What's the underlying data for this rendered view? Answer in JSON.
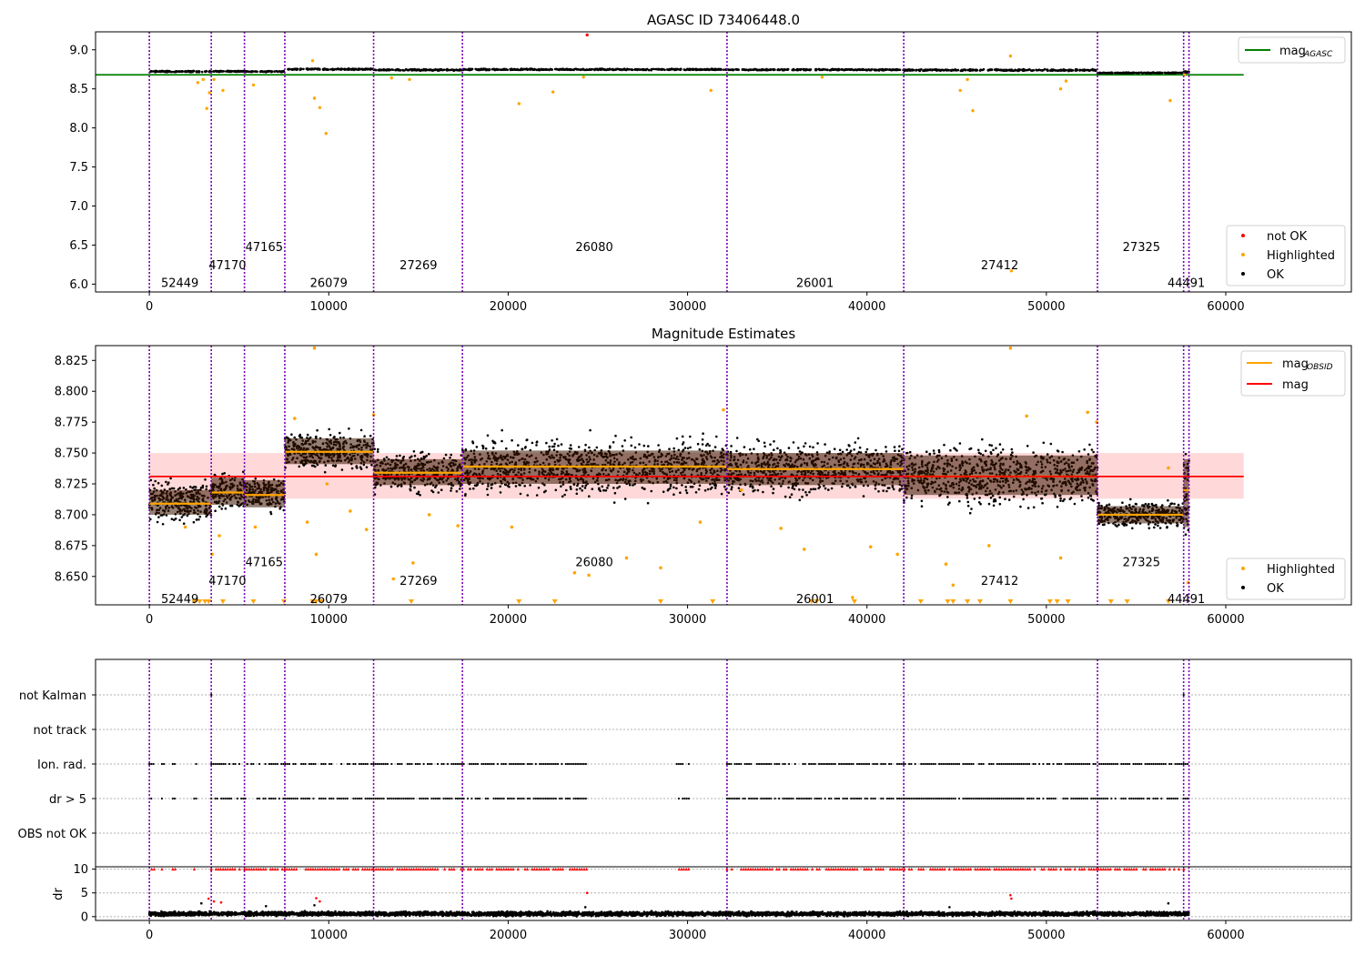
{
  "chart_data": [
    {
      "type": "scatter",
      "title": "AGASC ID 73406448.0",
      "xlim": [
        -3000,
        67000
      ],
      "ylim": [
        5.9,
        9.23
      ],
      "xticks": [
        0,
        10000,
        20000,
        30000,
        40000,
        50000,
        60000
      ],
      "xtick_labels": [
        "0",
        "10000",
        "20000",
        "30000",
        "40000",
        "50000",
        "60000"
      ],
      "yticks": [
        6.0,
        6.5,
        7.0,
        7.5,
        8.0,
        8.5,
        9.0
      ],
      "ytick_labels": [
        "6.0",
        "6.5",
        "7.0",
        "7.5",
        "8.0",
        "8.5",
        "9.0"
      ],
      "grid": false,
      "reference_line": {
        "name": "mag_AGASC",
        "y": 8.68,
        "x": [
          -3000,
          61000
        ],
        "color": "#008000"
      },
      "legend_lines": {
        "label": "mag",
        "sub": "AGASC",
        "placement": "top-right"
      },
      "legend_points": {
        "placement": "bottom-right",
        "items": [
          {
            "label": "not OK",
            "color": "#ff0000"
          },
          {
            "label": "Highlighted",
            "color": "#ffa500"
          },
          {
            "label": "OK",
            "color": "#000000"
          }
        ]
      },
      "obsid_boundaries": [
        0,
        3450,
        5300,
        7550,
        12500,
        17450,
        32200,
        42050,
        52850,
        57650,
        57950
      ],
      "obsid_labels": [
        {
          "text": "52449",
          "x": 1700,
          "y": 6.02
        },
        {
          "text": "47170",
          "x": 4350,
          "y": 6.25
        },
        {
          "text": "47165",
          "x": 6400,
          "y": 6.48
        },
        {
          "text": "26079",
          "x": 10000,
          "y": 6.02
        },
        {
          "text": "27269",
          "x": 15000,
          "y": 6.25
        },
        {
          "text": "26080",
          "x": 24800,
          "y": 6.48
        },
        {
          "text": "26001",
          "x": 37100,
          "y": 6.02
        },
        {
          "text": "27412",
          "x": 47400,
          "y": 6.25
        },
        {
          "text": "27325",
          "x": 55300,
          "y": 6.48
        },
        {
          "text": "44491",
          "x": 57800,
          "y": 6.02
        }
      ],
      "band_series": [
        {
          "x": [
            0,
            3450
          ],
          "center": 8.722,
          "spread": 0.012
        },
        {
          "x": [
            3450,
            5300
          ],
          "center": 8.724,
          "spread": 0.01
        },
        {
          "x": [
            5300,
            7550
          ],
          "center": 8.722,
          "spread": 0.01
        },
        {
          "x": [
            7550,
            12500
          ],
          "center": 8.752,
          "spread": 0.012
        },
        {
          "x": [
            12500,
            17450
          ],
          "center": 8.742,
          "spread": 0.012
        },
        {
          "x": [
            17450,
            32200
          ],
          "center": 8.748,
          "spread": 0.013
        },
        {
          "x": [
            32200,
            42050
          ],
          "center": 8.745,
          "spread": 0.012
        },
        {
          "x": [
            42050,
            52850
          ],
          "center": 8.74,
          "spread": 0.014
        },
        {
          "x": [
            52850,
            57650
          ],
          "center": 8.705,
          "spread": 0.008
        },
        {
          "x": [
            57650,
            57950
          ],
          "center": 8.715,
          "spread": 0.02
        }
      ],
      "highlighted_points": [
        {
          "x": 2700,
          "y": 8.58
        },
        {
          "x": 3000,
          "y": 8.62
        },
        {
          "x": 3200,
          "y": 8.25
        },
        {
          "x": 3350,
          "y": 8.45
        },
        {
          "x": 3600,
          "y": 8.62
        },
        {
          "x": 4100,
          "y": 8.48
        },
        {
          "x": 5800,
          "y": 8.55
        },
        {
          "x": 9100,
          "y": 8.86
        },
        {
          "x": 9200,
          "y": 8.38
        },
        {
          "x": 9500,
          "y": 8.26
        },
        {
          "x": 9850,
          "y": 7.93
        },
        {
          "x": 13500,
          "y": 8.64
        },
        {
          "x": 14500,
          "y": 8.62
        },
        {
          "x": 20600,
          "y": 8.31
        },
        {
          "x": 22500,
          "y": 8.46
        },
        {
          "x": 24200,
          "y": 8.65
        },
        {
          "x": 31300,
          "y": 8.48
        },
        {
          "x": 37500,
          "y": 8.65
        },
        {
          "x": 45200,
          "y": 8.48
        },
        {
          "x": 45600,
          "y": 8.62
        },
        {
          "x": 45900,
          "y": 8.22
        },
        {
          "x": 48000,
          "y": 8.92
        },
        {
          "x": 48050,
          "y": 6.17
        },
        {
          "x": 50800,
          "y": 8.5
        },
        {
          "x": 51100,
          "y": 8.6
        },
        {
          "x": 56900,
          "y": 8.35
        },
        {
          "x": 57700,
          "y": 8.68
        }
      ],
      "notok_points": [
        {
          "x": 24400,
          "y": 9.19
        }
      ]
    },
    {
      "type": "scatter",
      "title": "Magnitude Estimates",
      "xlim": [
        -3000,
        67000
      ],
      "ylim": [
        8.627,
        8.837
      ],
      "xticks": [
        0,
        10000,
        20000,
        30000,
        40000,
        50000,
        60000
      ],
      "xtick_labels": [
        "0",
        "10000",
        "20000",
        "30000",
        "40000",
        "50000",
        "60000"
      ],
      "yticks": [
        8.65,
        8.675,
        8.7,
        8.725,
        8.75,
        8.775,
        8.8,
        8.825
      ],
      "ytick_labels": [
        "8.650",
        "8.675",
        "8.700",
        "8.725",
        "8.750",
        "8.775",
        "8.800",
        "8.825"
      ],
      "grid": false,
      "mag_line": {
        "name": "mag",
        "y": 8.731,
        "x": [
          0,
          61000
        ],
        "color": "#ff0000"
      },
      "mag_band": {
        "y": [
          8.713,
          8.75
        ],
        "x": [
          0,
          61000
        ],
        "color": "#ffcccc"
      },
      "legend_lines": {
        "placement": "top-right",
        "items": [
          {
            "label": "mag",
            "sub": "OBSID",
            "color": "#ffa500"
          },
          {
            "label": "mag",
            "sub": "",
            "color": "#ff0000"
          }
        ]
      },
      "legend_points": {
        "placement": "bottom-right",
        "items": [
          {
            "label": "Highlighted",
            "color": "#ffa500"
          },
          {
            "label": "OK",
            "color": "#000000"
          }
        ]
      },
      "obsid_boundaries": [
        0,
        3450,
        5300,
        7550,
        12500,
        17450,
        32200,
        42050,
        52850,
        57650,
        57950
      ],
      "obsid_labels": [
        {
          "text": "52449",
          "x": 1700,
          "y": 8.632
        },
        {
          "text": "47170",
          "x": 4350,
          "y": 8.647
        },
        {
          "text": "47165",
          "x": 6400,
          "y": 8.662
        },
        {
          "text": "26079",
          "x": 10000,
          "y": 8.632
        },
        {
          "text": "27269",
          "x": 15000,
          "y": 8.647
        },
        {
          "text": "26080",
          "x": 24800,
          "y": 8.662
        },
        {
          "text": "26001",
          "x": 37100,
          "y": 8.632
        },
        {
          "text": "27412",
          "x": 47400,
          "y": 8.647
        },
        {
          "text": "27325",
          "x": 55300,
          "y": 8.662
        },
        {
          "text": "44491",
          "x": 57800,
          "y": 8.632
        }
      ],
      "obsid_means": [
        {
          "x": [
            0,
            3450
          ],
          "mag": 8.709,
          "band": [
            8.7,
            8.72
          ],
          "spread": [
            8.69,
            8.735
          ]
        },
        {
          "x": [
            3450,
            5300
          ],
          "mag": 8.718,
          "band": [
            8.708,
            8.73
          ],
          "spread": [
            8.702,
            8.742
          ]
        },
        {
          "x": [
            5300,
            7550
          ],
          "mag": 8.716,
          "band": [
            8.706,
            8.728
          ],
          "spread": [
            8.702,
            8.74
          ]
        },
        {
          "x": [
            7550,
            12500
          ],
          "mag": 8.751,
          "band": [
            8.741,
            8.762
          ],
          "spread": [
            8.73,
            8.772
          ]
        },
        {
          "x": [
            12500,
            17450
          ],
          "mag": 8.734,
          "band": [
            8.724,
            8.745
          ],
          "spread": [
            8.712,
            8.755
          ]
        },
        {
          "x": [
            17450,
            32200
          ],
          "mag": 8.739,
          "band": [
            8.725,
            8.752
          ],
          "spread": [
            8.71,
            8.772
          ]
        },
        {
          "x": [
            32200,
            42050
          ],
          "mag": 8.737,
          "band": [
            8.724,
            8.75
          ],
          "spread": [
            8.712,
            8.768
          ]
        },
        {
          "x": [
            42050,
            52850
          ],
          "mag": 8.731,
          "band": [
            8.716,
            8.748
          ],
          "spread": [
            8.702,
            8.768
          ]
        },
        {
          "x": [
            52850,
            57650
          ],
          "mag": 8.7,
          "band": [
            8.693,
            8.707
          ],
          "spread": [
            8.688,
            8.716
          ]
        },
        {
          "x": [
            57650,
            57950
          ],
          "mag": 8.72,
          "band": [
            8.69,
            8.745
          ],
          "spread": [
            8.675,
            8.765
          ]
        }
      ],
      "highlighted_points": [
        {
          "x": 9200,
          "y": 8.835
        },
        {
          "x": 48000,
          "y": 8.835
        },
        {
          "x": 2000,
          "y": 8.69
        },
        {
          "x": 3500,
          "y": 8.668
        },
        {
          "x": 3900,
          "y": 8.683
        },
        {
          "x": 5900,
          "y": 8.69
        },
        {
          "x": 8100,
          "y": 8.778
        },
        {
          "x": 8800,
          "y": 8.694
        },
        {
          "x": 9300,
          "y": 8.668
        },
        {
          "x": 9900,
          "y": 8.725
        },
        {
          "x": 11200,
          "y": 8.703
        },
        {
          "x": 12100,
          "y": 8.688
        },
        {
          "x": 12500,
          "y": 8.781
        },
        {
          "x": 13600,
          "y": 8.648
        },
        {
          "x": 14700,
          "y": 8.661
        },
        {
          "x": 15600,
          "y": 8.7
        },
        {
          "x": 17200,
          "y": 8.691
        },
        {
          "x": 20200,
          "y": 8.69
        },
        {
          "x": 23700,
          "y": 8.653
        },
        {
          "x": 24500,
          "y": 8.651
        },
        {
          "x": 26600,
          "y": 8.665
        },
        {
          "x": 28500,
          "y": 8.657
        },
        {
          "x": 30700,
          "y": 8.694
        },
        {
          "x": 32000,
          "y": 8.785
        },
        {
          "x": 33000,
          "y": 8.72
        },
        {
          "x": 35200,
          "y": 8.689
        },
        {
          "x": 36500,
          "y": 8.672
        },
        {
          "x": 39200,
          "y": 8.633
        },
        {
          "x": 40200,
          "y": 8.674
        },
        {
          "x": 41700,
          "y": 8.668
        },
        {
          "x": 44400,
          "y": 8.66
        },
        {
          "x": 44800,
          "y": 8.643
        },
        {
          "x": 46800,
          "y": 8.675
        },
        {
          "x": 48900,
          "y": 8.78
        },
        {
          "x": 50800,
          "y": 8.665
        },
        {
          "x": 52300,
          "y": 8.783
        },
        {
          "x": 52800,
          "y": 8.775
        },
        {
          "x": 56800,
          "y": 8.738
        },
        {
          "x": 57900,
          "y": 8.645
        }
      ],
      "low_markers_x": [
        2500,
        2800,
        3100,
        3300,
        4100,
        5800,
        7500,
        9100,
        9300,
        9600,
        14600,
        20600,
        22600,
        28500,
        31400,
        36900,
        37200,
        39300,
        43000,
        44500,
        44800,
        45600,
        46300,
        48000,
        50200,
        50600,
        51200,
        53600,
        54500,
        56800
      ]
    },
    {
      "type": "scatter",
      "title": "",
      "xlim": [
        -3000,
        67000
      ],
      "categories": [
        "not Kalman",
        "not track",
        "Ion. rad.",
        "dr > 5",
        "OBS not OK"
      ],
      "grid": "y-dotted",
      "obsid_boundaries": [
        0,
        3450,
        5300,
        7550,
        12500,
        17450,
        32200,
        42050,
        52850,
        57650,
        57950
      ],
      "flag_points": {
        "not Kalman": [
          3450,
          57650
        ],
        "not track": [],
        "Ion. rad.": [
          [
            0,
            300
          ],
          [
            700,
            900
          ],
          [
            1300,
            1500
          ],
          [
            2500,
            2650
          ],
          [
            3450,
            12500
          ],
          [
            12500,
            24400
          ],
          [
            29400,
            30100
          ],
          [
            32200,
            57950
          ]
        ],
        "dr > 5": [
          [
            0,
            300
          ],
          [
            700,
            900
          ],
          [
            1300,
            1500
          ],
          [
            2500,
            2650
          ],
          [
            3450,
            12500
          ],
          [
            12500,
            24400
          ],
          [
            29400,
            30100
          ],
          [
            32200,
            57950
          ]
        ],
        "OBS not OK": []
      }
    },
    {
      "type": "scatter",
      "title": "",
      "ylabel": "dr",
      "xlim": [
        -3000,
        67000
      ],
      "ylim": [
        -0.8,
        10.5
      ],
      "xticks": [
        0,
        10000,
        20000,
        30000,
        40000,
        50000,
        60000
      ],
      "xtick_labels": [
        "0",
        "10000",
        "20000",
        "30000",
        "40000",
        "50000",
        "60000"
      ],
      "yticks": [
        0,
        5,
        10
      ],
      "ytick_labels": [
        "0",
        "5",
        "10"
      ],
      "grid": "y-dotted",
      "obsid_boundaries": [
        0,
        3450,
        5300,
        7550,
        12500,
        17450,
        32200,
        42050,
        52850,
        57650,
        57950
      ],
      "baseline": {
        "center": 0.6,
        "spread": 0.6,
        "x": [
          0,
          57950
        ]
      },
      "capped_markers_y": 10,
      "capped_ranges": [
        [
          0,
          300
        ],
        [
          700,
          900
        ],
        [
          1300,
          1500
        ],
        [
          2500,
          2650
        ],
        [
          3450,
          12500
        ],
        [
          12500,
          24400
        ],
        [
          29400,
          30100
        ],
        [
          32200,
          57950
        ]
      ],
      "red_points": [
        {
          "x": 3300,
          "y": 3.8
        },
        {
          "x": 3600,
          "y": 3.2
        },
        {
          "x": 4000,
          "y": 3.0
        },
        {
          "x": 9300,
          "y": 3.9
        },
        {
          "x": 9500,
          "y": 3.2
        },
        {
          "x": 24400,
          "y": 5.0
        },
        {
          "x": 48000,
          "y": 4.5
        },
        {
          "x": 48050,
          "y": 3.8
        }
      ],
      "outliers": [
        {
          "x": 2900,
          "y": 2.8
        },
        {
          "x": 6500,
          "y": 2.2
        },
        {
          "x": 9200,
          "y": 2.4
        },
        {
          "x": 24300,
          "y": 2.0
        },
        {
          "x": 44600,
          "y": 2.0
        },
        {
          "x": 56800,
          "y": 2.8
        }
      ]
    }
  ]
}
